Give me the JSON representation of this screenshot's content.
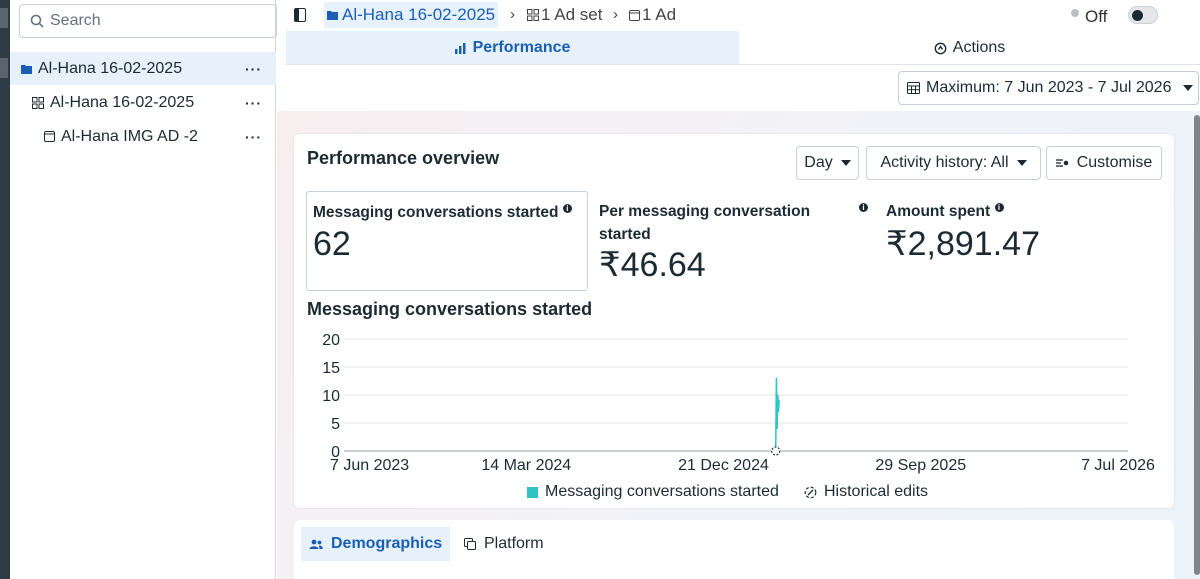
{
  "search": {
    "placeholder": "Search"
  },
  "tree": [
    {
      "label": "Al-Hana 16-02-2025",
      "icon": "folder-icon",
      "more": "···"
    },
    {
      "label": "Al-Hana 16-02-2025",
      "icon": "grid-icon",
      "more": "···"
    },
    {
      "label": "Al-Hana IMG AD -2",
      "icon": "ad-icon",
      "more": "···"
    }
  ],
  "breadcrumb": {
    "campaign": "Al-Hana 16-02-2025",
    "adset": "1 Ad set",
    "ad": "1 Ad"
  },
  "status": {
    "label": "Off"
  },
  "tabs": [
    {
      "label": "Performance",
      "icon": "bar-chart-icon"
    },
    {
      "label": "Actions",
      "icon": "actions-icon"
    }
  ],
  "date_range": {
    "label": "Maximum: 7 Jun 2023 - 7 Jul 2026"
  },
  "overview": {
    "title": "Performance overview",
    "granularity": "Day",
    "activity": "Activity history: All",
    "customise": "Customise"
  },
  "metrics": [
    {
      "label": "Messaging conversations started",
      "value": "62"
    },
    {
      "label": "Per messaging conversation started",
      "value": "₹46.64"
    },
    {
      "label": "Amount spent",
      "value": "₹2,891.47"
    }
  ],
  "chart_title": "Messaging conversations started",
  "chart_data": {
    "type": "line",
    "title": "Messaging conversations started",
    "xlabel": "",
    "ylabel": "",
    "ylim": [
      0,
      20
    ],
    "yticks": [
      "20",
      "15",
      "10",
      "5",
      "0"
    ],
    "xticks": [
      "7 Jun 2023",
      "14 Mar 2024",
      "21 Dec 2024",
      "29 Sep 2025",
      "7 Jul 2026"
    ],
    "x_range": [
      "2023-06-07",
      "2026-07-07"
    ],
    "series": [
      {
        "name": "Messaging conversations started",
        "color": "#2ec4c4",
        "points": [
          {
            "x": "2025-02-16",
            "y": 0
          },
          {
            "x": "2025-02-17",
            "y": 13
          },
          {
            "x": "2025-02-18",
            "y": 4
          },
          {
            "x": "2025-02-19",
            "y": 10
          },
          {
            "x": "2025-02-20",
            "y": 7
          },
          {
            "x": "2025-02-21",
            "y": 9
          }
        ]
      }
    ],
    "annotations": [
      {
        "x": "2025-02-16",
        "label": "historical-edit-icon"
      }
    ],
    "grid": true,
    "legend": [
      "Messaging conversations started",
      "Historical edits"
    ]
  },
  "legend": {
    "series": "Messaging conversations started",
    "edits": "Historical edits"
  },
  "breakdown_tabs": [
    {
      "label": "Demographics",
      "icon": "people-icon"
    },
    {
      "label": "Platform",
      "icon": "copy-icon"
    }
  ]
}
